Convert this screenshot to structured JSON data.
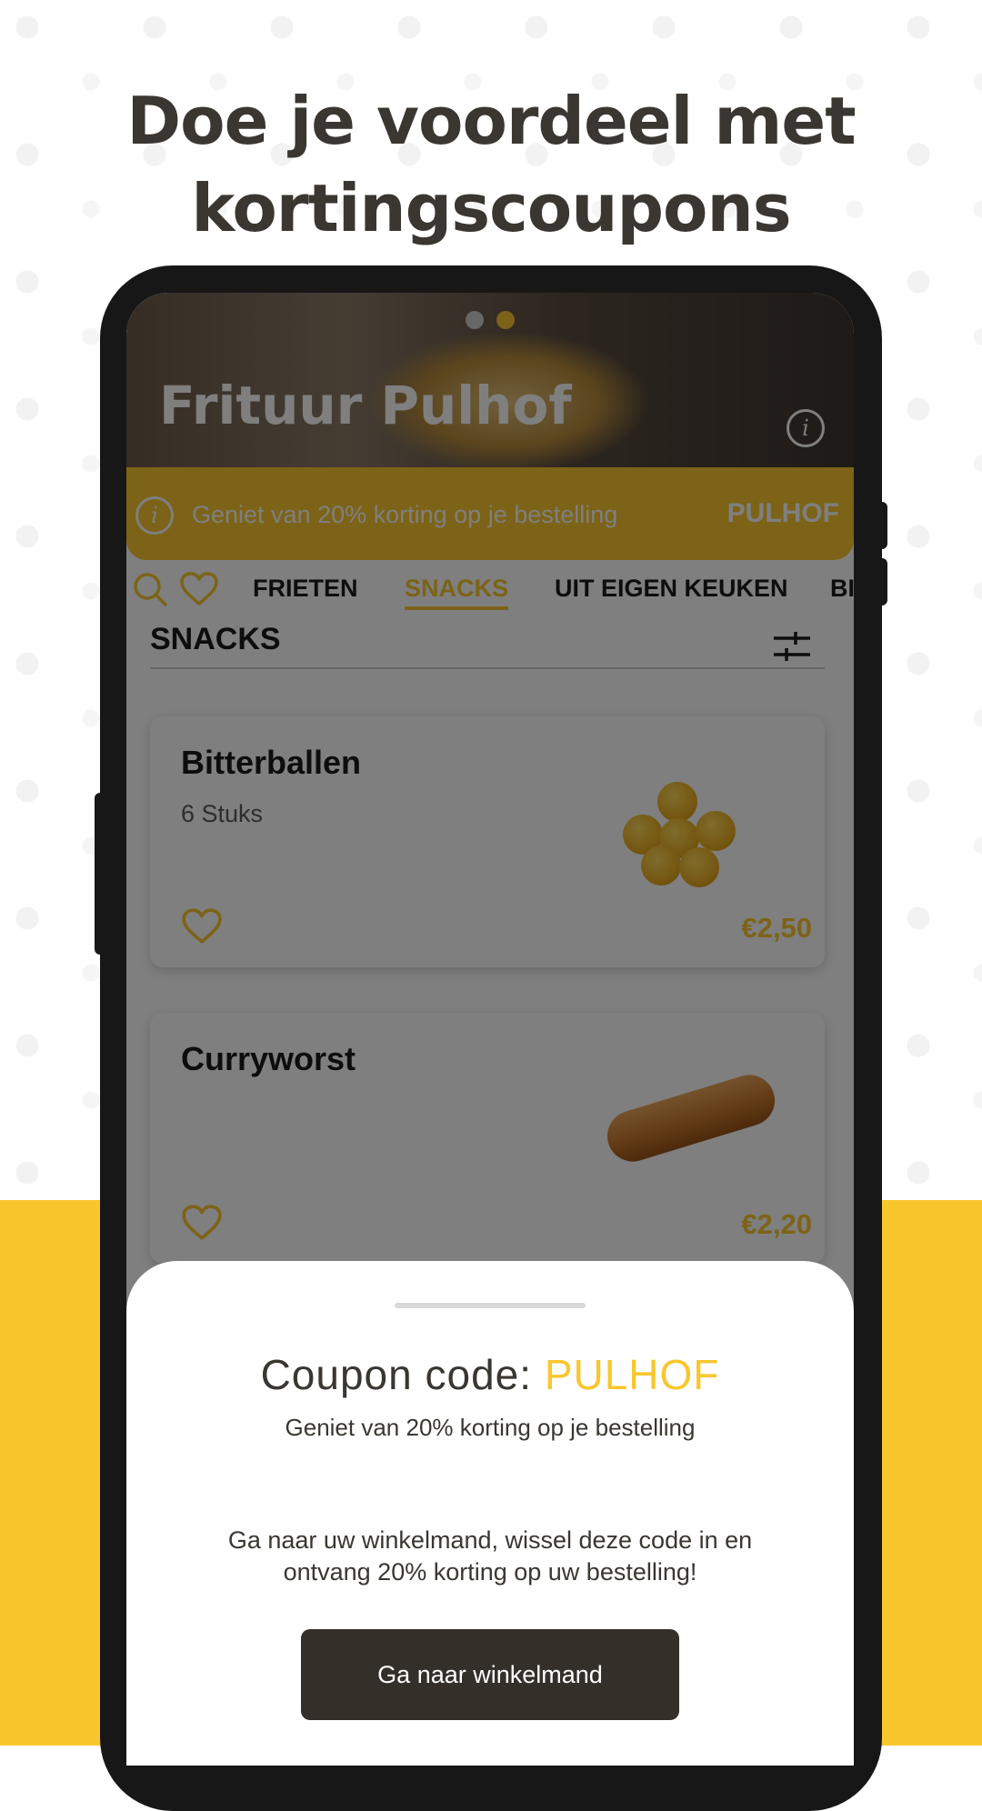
{
  "headline": {
    "line1": "Doe je voordeel met",
    "line2": "kortingscoupons"
  },
  "colors": {
    "accent": "#f8c72e",
    "dark": "#352f29",
    "text": "#3a3631"
  },
  "app": {
    "restaurant_name": "Frituur Pulhof",
    "carousel": {
      "count": 2,
      "active_index": 1
    },
    "banner": {
      "text": "Geniet van 20% korting op je bestelling",
      "code": "PULHOF"
    },
    "tabs": [
      {
        "label": "FRIETEN",
        "active": false
      },
      {
        "label": "SNACKS",
        "active": true
      },
      {
        "label": "UIT EIGEN KEUKEN",
        "active": false
      },
      {
        "label": "BI",
        "active": false
      }
    ],
    "section_title": "SNACKS",
    "products": [
      {
        "name": "Bitterballen",
        "description": "6 Stuks",
        "price": "€2,50"
      },
      {
        "name": "Curryworst",
        "description": "",
        "price": "€2,20"
      }
    ]
  },
  "sheet": {
    "title_prefix": "Coupon code: ",
    "code": "PULHOF",
    "subtitle": "Geniet van 20% korting op je bestelling",
    "body": "Ga naar uw winkelmand, wissel deze code in en ontvang 20% korting op uw bestelling!",
    "button_label": "Ga naar winkelmand"
  },
  "icons": {
    "search": "search-icon",
    "favorites": "heart-icon",
    "filter": "filter-sliders-icon",
    "info": "info-icon"
  }
}
